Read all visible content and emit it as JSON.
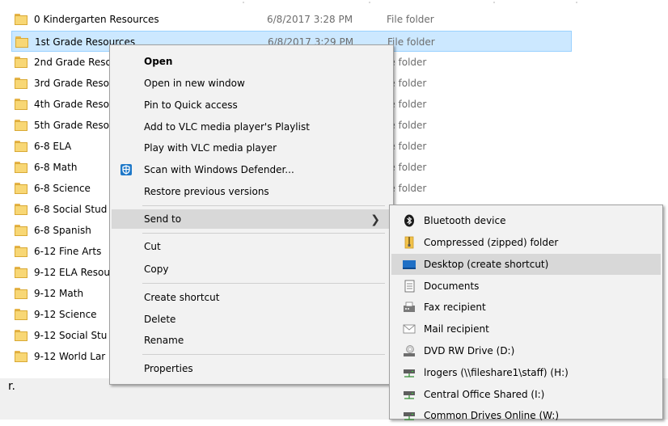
{
  "files": [
    {
      "name": "0 Kindergarten Resources",
      "date": "6/8/2017 3:28 PM",
      "type": "File folder"
    },
    {
      "name": "1st Grade Resources",
      "date": "6/8/2017 3:29 PM",
      "type": "File folder"
    },
    {
      "name": "2nd Grade Reso",
      "date": "",
      "type": "le folder"
    },
    {
      "name": "3rd Grade Reso",
      "date": "",
      "type": "le folder"
    },
    {
      "name": "4th Grade Reso",
      "date": "",
      "type": "le folder"
    },
    {
      "name": "5th Grade Reso",
      "date": "",
      "type": "le folder"
    },
    {
      "name": "6-8 ELA",
      "date": "",
      "type": "le folder"
    },
    {
      "name": "6-8 Math",
      "date": "",
      "type": "le folder"
    },
    {
      "name": "6-8 Science",
      "date": "",
      "type": "le folder"
    },
    {
      "name": "6-8 Social Stud",
      "date": "",
      "type": ""
    },
    {
      "name": "6-8 Spanish",
      "date": "",
      "type": ""
    },
    {
      "name": "6-12 Fine Arts",
      "date": "",
      "type": ""
    },
    {
      "name": "9-12 ELA Resou",
      "date": "",
      "type": ""
    },
    {
      "name": "9-12 Math",
      "date": "",
      "type": ""
    },
    {
      "name": "9-12 Science",
      "date": "",
      "type": ""
    },
    {
      "name": "9-12 Social Stu",
      "date": "",
      "type": ""
    },
    {
      "name": "9-12 World Lar",
      "date": "",
      "type": ""
    }
  ],
  "status_fragment": "r.",
  "context_menu": {
    "open": "Open",
    "open_new_window": "Open in new window",
    "pin_quick_access": "Pin to Quick access",
    "add_vlc_playlist": "Add to VLC media player's Playlist",
    "play_vlc": "Play with VLC media player",
    "scan_defender": "Scan with Windows Defender...",
    "restore_versions": "Restore previous versions",
    "send_to": "Send to",
    "cut": "Cut",
    "copy": "Copy",
    "create_shortcut": "Create shortcut",
    "delete": "Delete",
    "rename": "Rename",
    "properties": "Properties"
  },
  "send_to_menu": [
    {
      "label": "Bluetooth device",
      "icon": "bluetooth-icon"
    },
    {
      "label": "Compressed (zipped) folder",
      "icon": "zip-folder-icon"
    },
    {
      "label": "Desktop (create shortcut)",
      "icon": "desktop-icon"
    },
    {
      "label": "Documents",
      "icon": "documents-icon"
    },
    {
      "label": "Fax recipient",
      "icon": "fax-icon"
    },
    {
      "label": "Mail recipient",
      "icon": "mail-icon"
    },
    {
      "label": "DVD RW Drive (D:)",
      "icon": "dvd-drive-icon"
    },
    {
      "label": "lrogers (\\\\fileshare1\\staff) (H:)",
      "icon": "network-drive-icon"
    },
    {
      "label": "Central Office Shared (I:)",
      "icon": "network-drive-icon"
    },
    {
      "label": "Common Drives Online (W:)",
      "icon": "network-drive-icon"
    }
  ],
  "colors": {
    "selection": "#cce8ff",
    "menu_bg": "#f2f2f2",
    "hover": "#d8d8d8",
    "folder": "#f8d775"
  }
}
